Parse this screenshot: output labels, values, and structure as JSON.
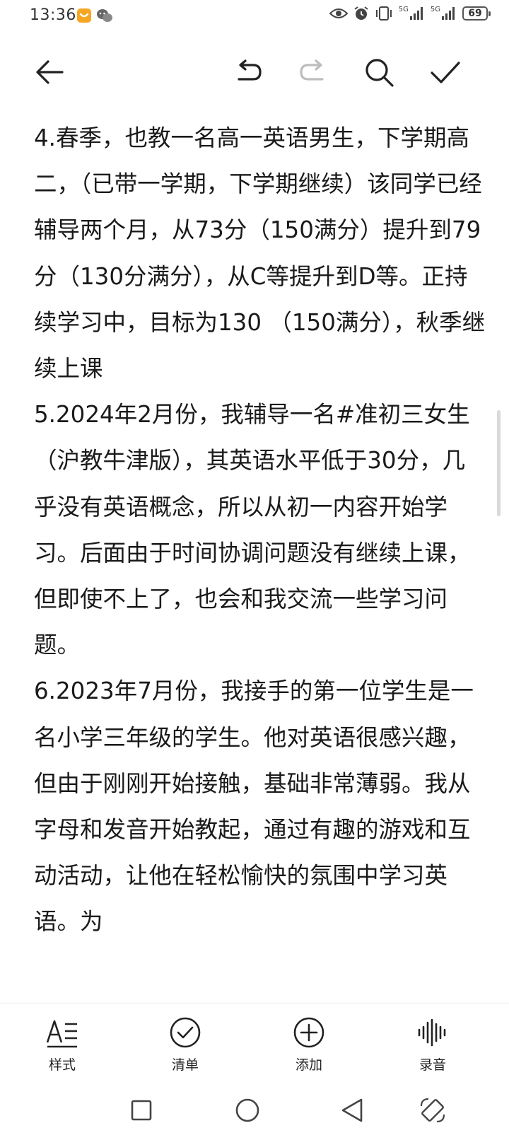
{
  "status_bar": {
    "time": "13:36",
    "network_1": "5G",
    "network_2": "5G",
    "battery": "69"
  },
  "toolbar": {
    "back": "back-arrow-icon",
    "undo": "undo-icon",
    "redo": "redo-icon",
    "search": "search-icon",
    "confirm": "checkmark-icon"
  },
  "note": {
    "paragraphs": [
      "4.春季，也教一名高一英语男生，下学期高二，（已带一学期，下学期继续）该同学已经辅导两个月，从73分（150满分）提升到79分（130分满分），从C等提升到D等。正持续学习中，目标为130 （150满分），秋季继续上课",
      "5.2024年2月份，我辅导一名#准初三女生（沪教牛津版），其英语水平低于30分，几乎没有英语概念，所以从初一内容开始学习。后面由于时间协调问题没有继续上课，但即使不上了，也会和我交流一些学习问题。",
      "6.2023年7月份，我接手的第一位学生是一名小学三年级的学生。他对英语很感兴趣，但由于刚刚开始接触，基础非常薄弱。我从字母和发音开始教起，通过有趣的游戏和互动活动，让他在轻松愉快的氛围中学习英语。为"
    ]
  },
  "bottom_bar": {
    "style_label": "样式",
    "checklist_label": "清单",
    "add_label": "添加",
    "record_label": "录音"
  },
  "colors": {
    "text": "#1a1a1a",
    "icon": "#222222",
    "disabled_icon": "#bdbdbd",
    "app_badge": "#f5a623"
  }
}
